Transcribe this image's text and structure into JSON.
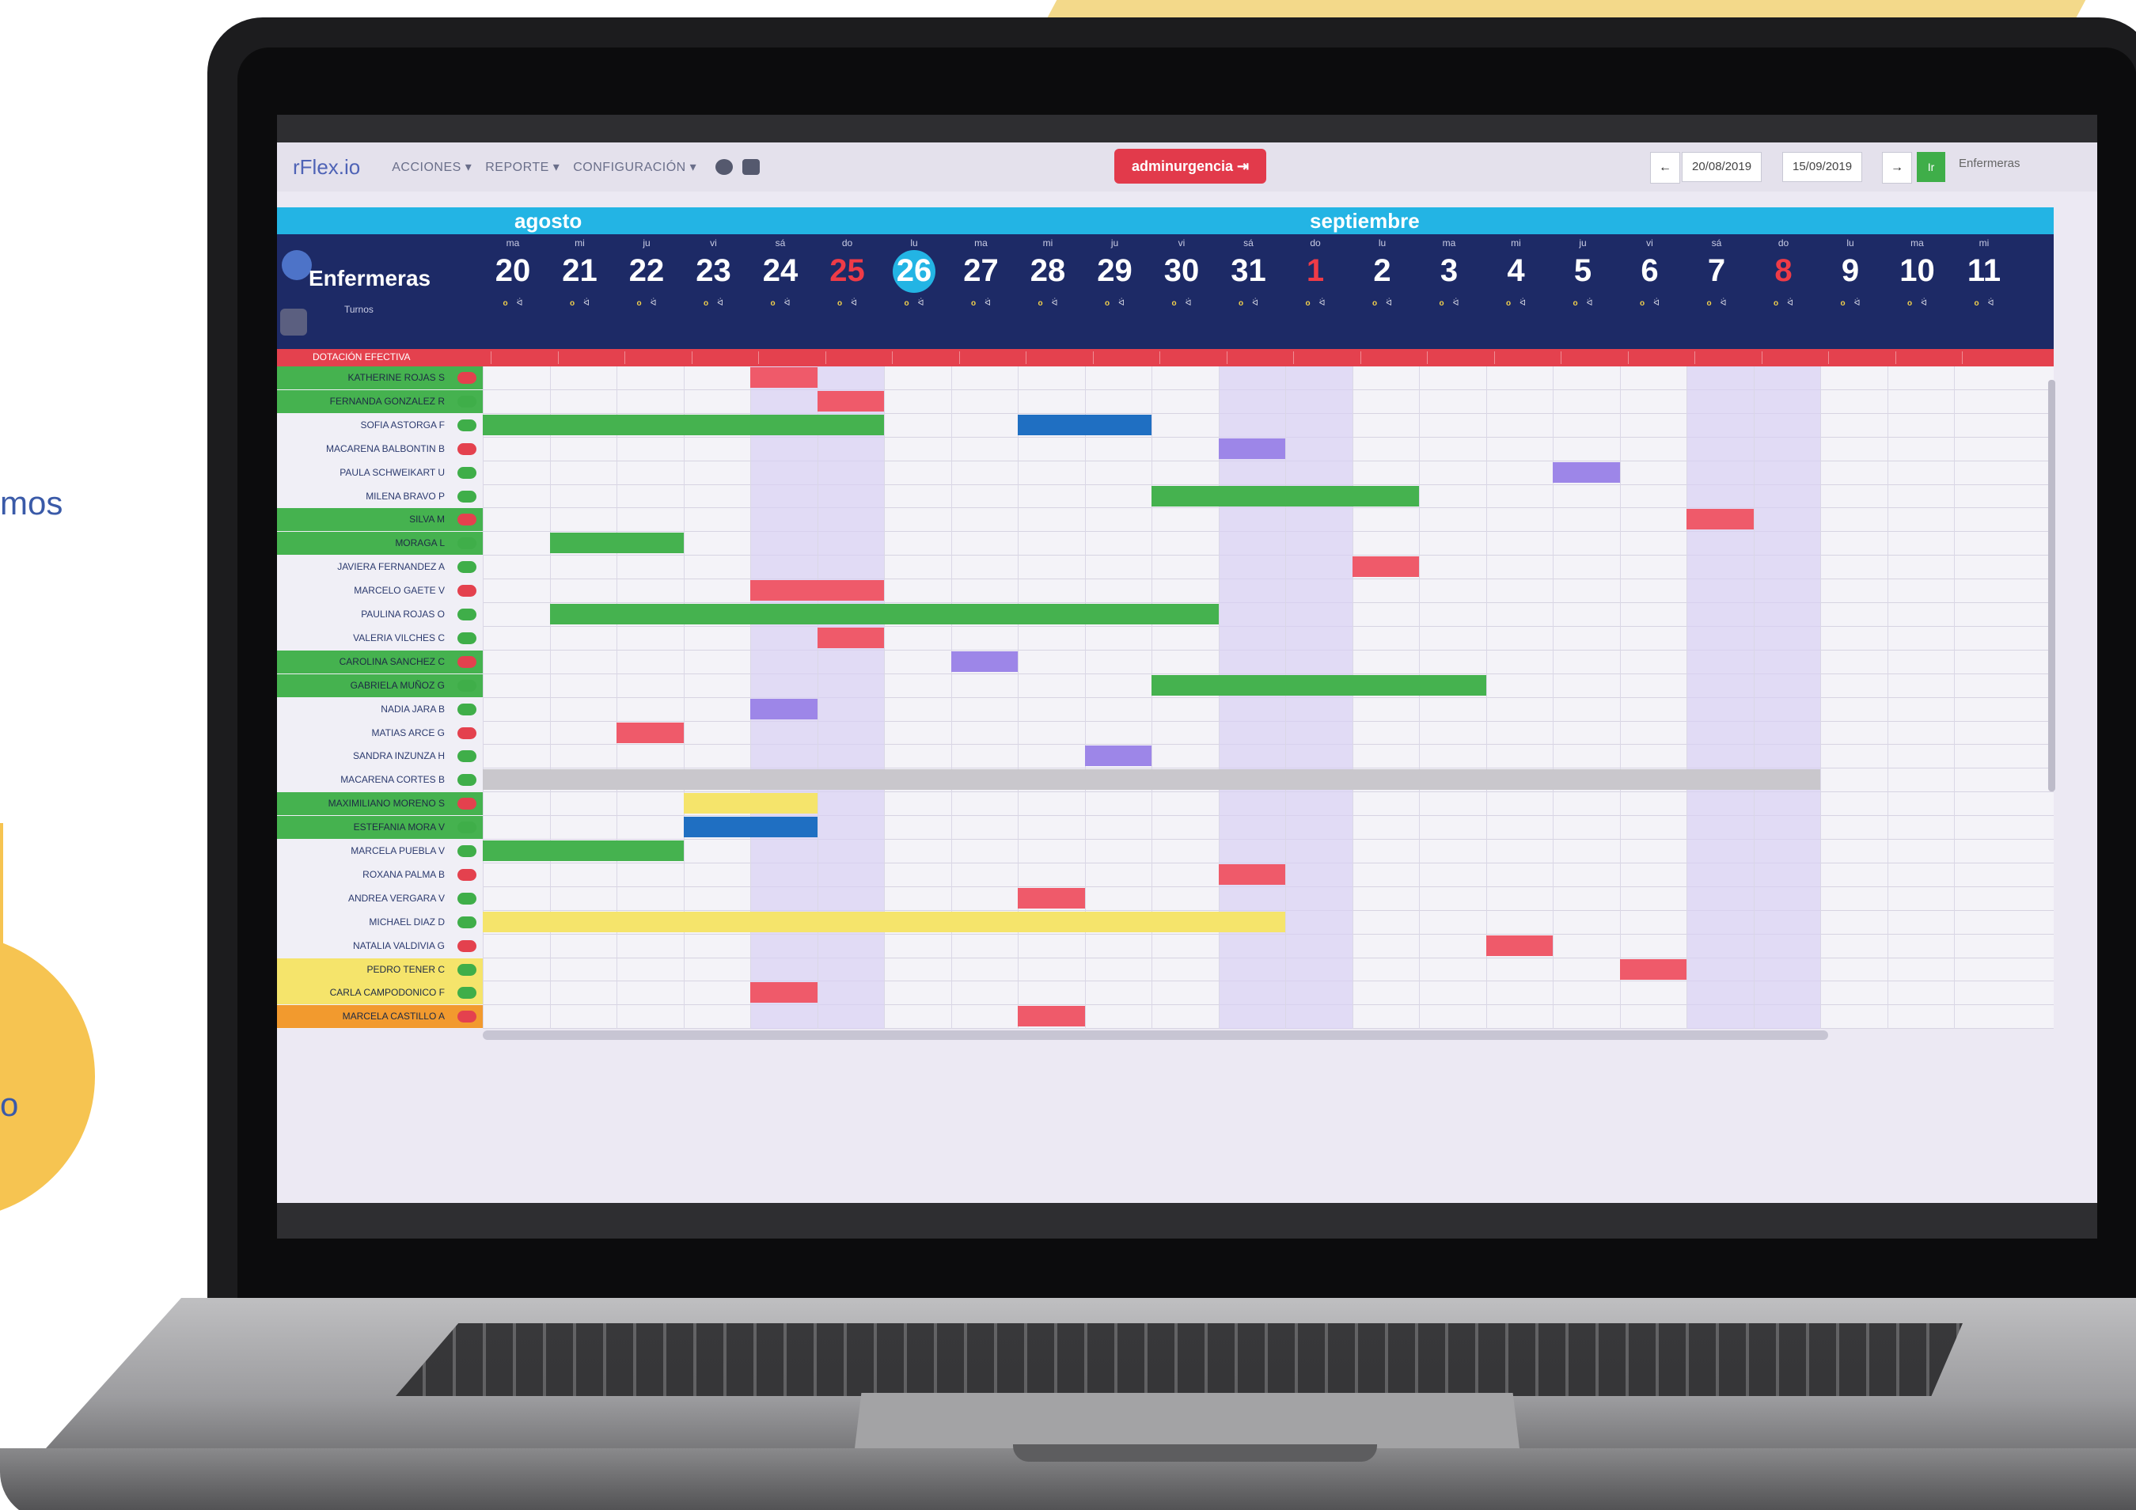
{
  "background": {
    "partial_text_1": "mos",
    "partial_text_2": "o"
  },
  "app": {
    "logo": "rFlex.io",
    "menu": [
      "ACCIONES ▾",
      "REPORTE ▾",
      "CONFIGURACIÓN ▾"
    ],
    "admin_label": "adminurgencia",
    "date_from": "20/08/2019",
    "date_to": "15/09/2019",
    "go_label": "Ir",
    "role_select": "Enfermeras"
  },
  "calendar": {
    "months": [
      "agosto",
      "septiembre"
    ],
    "title": "Enfermeras",
    "turnos_label": "Turnos",
    "dotacion_label": "DOTACIÓN EFECTIVA",
    "days": [
      {
        "dow": "ma",
        "num": "20"
      },
      {
        "dow": "mi",
        "num": "21"
      },
      {
        "dow": "ju",
        "num": "22"
      },
      {
        "dow": "vi",
        "num": "23"
      },
      {
        "dow": "sá",
        "num": "24"
      },
      {
        "dow": "do",
        "num": "25",
        "red": true
      },
      {
        "dow": "lu",
        "num": "26",
        "today": true
      },
      {
        "dow": "ma",
        "num": "27"
      },
      {
        "dow": "mi",
        "num": "28"
      },
      {
        "dow": "ju",
        "num": "29"
      },
      {
        "dow": "vi",
        "num": "30"
      },
      {
        "dow": "sá",
        "num": "31"
      },
      {
        "dow": "do",
        "num": "1",
        "red": true
      },
      {
        "dow": "lu",
        "num": "2"
      },
      {
        "dow": "ma",
        "num": "3"
      },
      {
        "dow": "mi",
        "num": "4"
      },
      {
        "dow": "ju",
        "num": "5"
      },
      {
        "dow": "vi",
        "num": "6"
      },
      {
        "dow": "sá",
        "num": "7"
      },
      {
        "dow": "do",
        "num": "8",
        "red": true
      },
      {
        "dow": "lu",
        "num": "9"
      },
      {
        "dow": "ma",
        "num": "10"
      },
      {
        "dow": "mi",
        "num": "11"
      }
    ],
    "staff": [
      {
        "name": "KATHERINE ROJAS S",
        "group": "green"
      },
      {
        "name": "FERNANDA GONZALEZ R",
        "group": "green"
      },
      {
        "name": "SOFIA ASTORGA F",
        "group": "none"
      },
      {
        "name": "MACARENA BALBONTIN B",
        "group": "none"
      },
      {
        "name": "PAULA SCHWEIKART U",
        "group": "none"
      },
      {
        "name": "MILENA BRAVO P",
        "group": "none"
      },
      {
        "name": "SILVA M",
        "group": "green"
      },
      {
        "name": "MORAGA L",
        "group": "green"
      },
      {
        "name": "JAVIERA FERNANDEZ A",
        "group": "none"
      },
      {
        "name": "MARCELO GAETE V",
        "group": "none"
      },
      {
        "name": "PAULINA ROJAS O",
        "group": "none"
      },
      {
        "name": "VALERIA VILCHES C",
        "group": "none"
      },
      {
        "name": "CAROLINA SANCHEZ C",
        "group": "green"
      },
      {
        "name": "GABRIELA MUÑOZ G",
        "group": "green"
      },
      {
        "name": "NADIA JARA B",
        "group": "none"
      },
      {
        "name": "MATIAS ARCE G",
        "group": "none"
      },
      {
        "name": "SANDRA INZUNZA H",
        "group": "none"
      },
      {
        "name": "MACARENA CORTES B",
        "group": "none"
      },
      {
        "name": "MAXIMILIANO MORENO S",
        "group": "green"
      },
      {
        "name": "ESTEFANIA MORA V",
        "group": "green"
      },
      {
        "name": "MARCELA PUEBLA V",
        "group": "none"
      },
      {
        "name": "ROXANA PALMA B",
        "group": "none"
      },
      {
        "name": "ANDREA VERGARA V",
        "group": "none"
      },
      {
        "name": "MICHAEL DIAZ D",
        "group": "none"
      },
      {
        "name": "NATALIA VALDIVIA G",
        "group": "none"
      },
      {
        "name": "PEDRO TENER C",
        "group": "yellow"
      },
      {
        "name": "CARLA CAMPODONICO F",
        "group": "yellow"
      },
      {
        "name": "MARCELA CASTILLO A",
        "group": "orange"
      }
    ]
  },
  "colors": {
    "accent": "#23b4e4",
    "header_bg": "#1d2a66",
    "danger": "#e4414e",
    "green": "#45b24f",
    "purple": "#9d86e8",
    "yellow": "#f5e46b"
  }
}
